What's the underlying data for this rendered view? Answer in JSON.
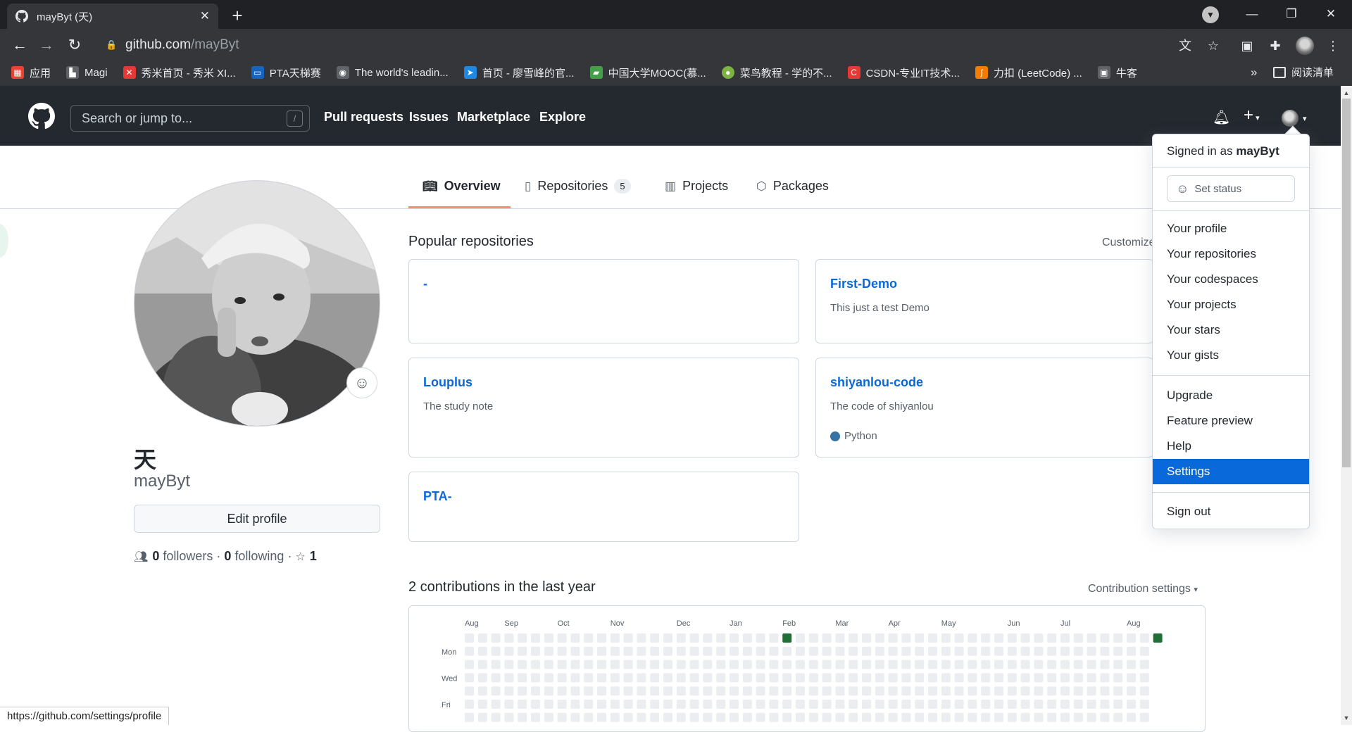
{
  "browser": {
    "tab_title": "mayByt (天)",
    "tab_close": "✕",
    "new_tab": "+",
    "url_host": "github.com",
    "url_path": "/mayByt",
    "bookmarks": [
      {
        "label": "应用",
        "color": "#ea4335",
        "glyph": "▦"
      },
      {
        "label": "Magi",
        "color": "#202124",
        "glyph": "▙"
      },
      {
        "label": "秀米首页 - 秀米 XI...",
        "color": "#e53935",
        "glyph": "✕"
      },
      {
        "label": "PTA天梯赛",
        "color": "#1565c0",
        "glyph": "▭"
      },
      {
        "label": "The world's leadin...",
        "color": "#202124",
        "glyph": "◉"
      },
      {
        "label": "首页 - 廖雪峰的官...",
        "color": "#1e88e5",
        "glyph": "➤"
      },
      {
        "label": "中国大学MOOC(慕...",
        "color": "#43a047",
        "glyph": "▰"
      },
      {
        "label": "菜鸟教程 - 学的不...",
        "color": "#7cb342",
        "glyph": "●"
      },
      {
        "label": "CSDN-专业IT技术...",
        "color": "#e53935",
        "glyph": "C"
      },
      {
        "label": "力扣 (LeetCode) ...",
        "color": "#f57c00",
        "glyph": "ʃ"
      },
      {
        "label": "牛客",
        "color": "#202124",
        "glyph": "▣"
      }
    ],
    "more_bookmarks": "»",
    "reading_list": "阅读清单",
    "status_url": "https://github.com/settings/profile"
  },
  "header": {
    "search_placeholder": "Search or jump to...",
    "search_key": "/",
    "nav": [
      "Pull requests",
      "Issues",
      "Marketplace",
      "Explore"
    ]
  },
  "tabs": {
    "overview": "Overview",
    "repositories": "Repositories",
    "repositories_count": "5",
    "projects": "Projects",
    "packages": "Packages"
  },
  "profile": {
    "name": "天",
    "login": "mayByt",
    "edit_button": "Edit profile",
    "followers_count": "0",
    "followers_label": "followers",
    "following_count": "0",
    "following_label": "following",
    "stars_count": "1"
  },
  "popular": {
    "title": "Popular repositories",
    "customize": "Customize",
    "repos": [
      {
        "name": "-",
        "description": "",
        "language": ""
      },
      {
        "name": "First-Demo",
        "description": "This just a test Demo",
        "language": ""
      },
      {
        "name": "Louplus",
        "description": "The study note",
        "language": ""
      },
      {
        "name": "shiyanlou-code",
        "description": "The code of shiyanlou",
        "language": "Python"
      },
      {
        "name": "PTA-",
        "description": "",
        "language": ""
      }
    ]
  },
  "contributions": {
    "title": "2 contributions in the last year",
    "settings": "Contribution settings",
    "months": [
      "Aug",
      "Sep",
      "Oct",
      "Nov",
      "Dec",
      "Jan",
      "Feb",
      "Mar",
      "Apr",
      "May",
      "Jun",
      "Jul",
      "Aug"
    ],
    "days": [
      "Mon",
      "Wed",
      "Fri"
    ],
    "weeks": 53,
    "filled": [
      {
        "week": 24,
        "day": 0
      },
      {
        "week": 52,
        "day": 0
      }
    ],
    "colors": {
      "empty": "#ebedf0",
      "level": "#216e39"
    }
  },
  "dropdown": {
    "signed_in_prefix": "Signed in as",
    "signed_in_user": "mayByt",
    "set_status": "Set status",
    "items_profile": [
      "Your profile",
      "Your repositories",
      "Your codespaces",
      "Your projects",
      "Your stars",
      "Your gists"
    ],
    "items_help": [
      "Upgrade",
      "Feature preview",
      "Help",
      "Settings"
    ],
    "sign_out": "Sign out",
    "active_item": "Settings"
  }
}
